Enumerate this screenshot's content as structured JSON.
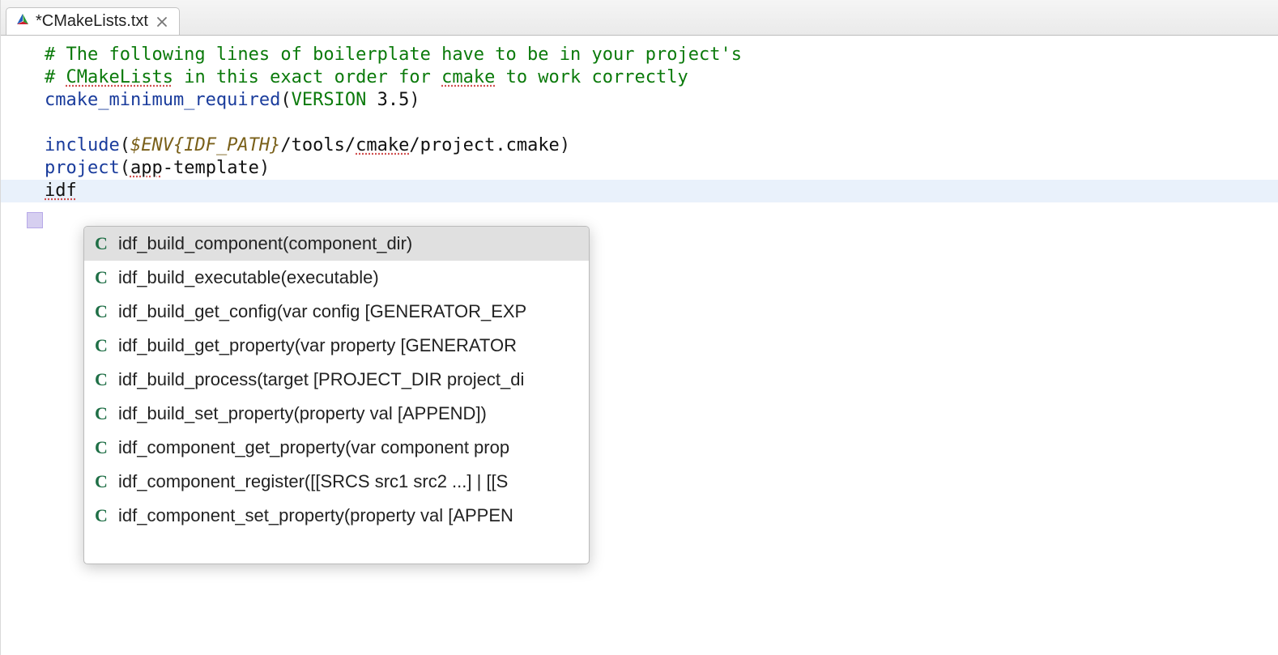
{
  "tab": {
    "title": "*CMakeLists.txt"
  },
  "code": {
    "l1_a": "# The following lines of boilerplate have to be in your project's",
    "l2_a": "# ",
    "l2_b": "CMakeLists",
    "l2_c": " in this exact order for ",
    "l2_d": "cmake",
    "l2_e": " to work correctly",
    "l3_a": "cmake_minimum_required",
    "l3_b": "(",
    "l3_c": "VERSION",
    "l3_d": " ",
    "l3_e": "3.5",
    "l3_f": ")",
    "l5_a": "include",
    "l5_b": "(",
    "l5_c": "$ENV{",
    "l5_d": "IDF_PATH",
    "l5_e": "}",
    "l5_f": "/tools/",
    "l5_g": "cmake",
    "l5_h": "/project.cmake",
    "l5_i": ")",
    "l6_a": "project",
    "l6_b": "(",
    "l6_c": "app",
    "l6_d": "-template",
    "l6_e": ")",
    "l7_a": "idf"
  },
  "suggestions": [
    "idf_build_component(component_dir)",
    "idf_build_executable(executable)",
    "idf_build_get_config(var config [GENERATOR_EXP",
    "idf_build_get_property(var property [GENERATOR",
    "idf_build_process(target [PROJECT_DIR project_di",
    "idf_build_set_property(property val [APPEND])",
    "idf_component_get_property(var component prop",
    "idf_component_register([[SRCS src1 src2 ...] | [[S",
    "idf_component_set_property(property val [APPEN"
  ]
}
